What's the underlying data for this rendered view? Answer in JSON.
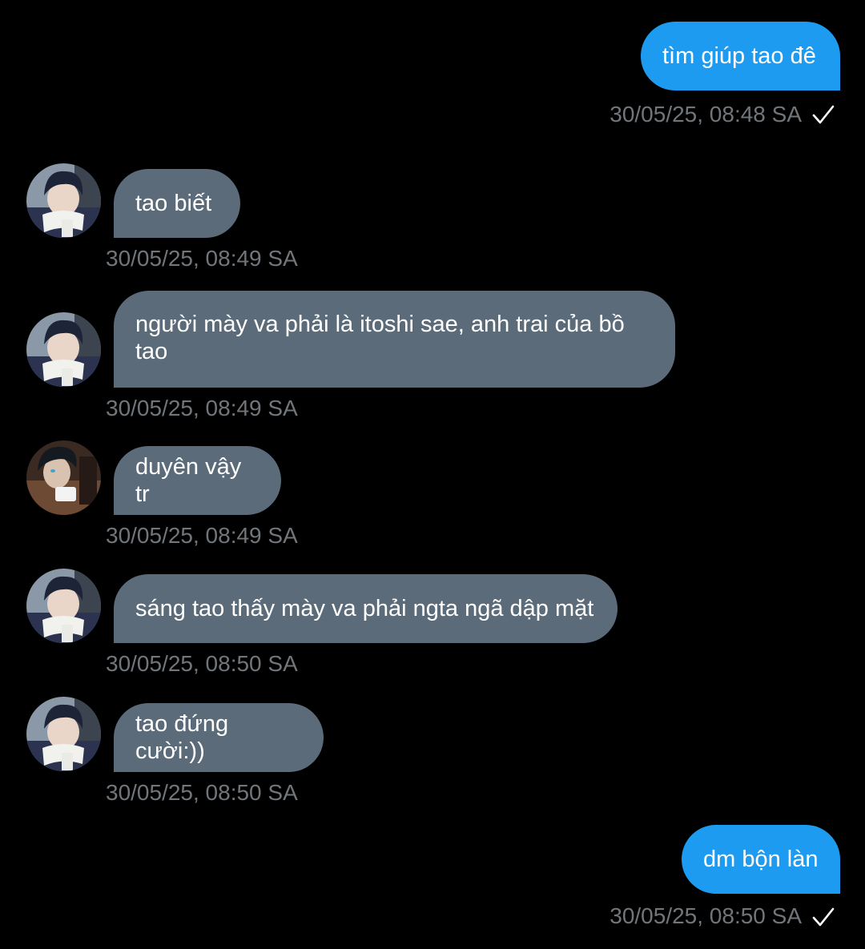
{
  "messages": [
    {
      "direction": "outgoing",
      "text": "tìm giúp tao đê",
      "time": "30/05/25, 08:48 SA",
      "status_icon": "check-icon"
    },
    {
      "direction": "incoming",
      "avatar": "avatar-boy-scarf",
      "text": "tao biết",
      "time": "30/05/25, 08:49 SA"
    },
    {
      "direction": "incoming",
      "avatar": "avatar-boy-scarf",
      "text": "người mày va phải là itoshi sae, anh trai của bồ tao",
      "time": "30/05/25, 08:49 SA"
    },
    {
      "direction": "incoming",
      "avatar": "avatar-dark-hair",
      "text": "duyên vậy tr",
      "time": "30/05/25, 08:49 SA"
    },
    {
      "direction": "incoming",
      "avatar": "avatar-boy-scarf",
      "text": "sáng tao thấy mày va phải ngta ngã dập mặt",
      "time": "30/05/25, 08:50 SA"
    },
    {
      "direction": "incoming",
      "avatar": "avatar-boy-scarf",
      "text": "tao đứng cười:))",
      "time": "30/05/25, 08:50 SA"
    },
    {
      "direction": "outgoing",
      "text": "dm bộn làn",
      "time": "30/05/25, 08:50 SA",
      "status_icon": "check-icon"
    }
  ],
  "colors": {
    "background": "#000000",
    "outgoing_bubble": "#1d9bf0",
    "incoming_bubble": "#5b6b79",
    "timestamp": "#71767b",
    "text": "#ffffff"
  }
}
